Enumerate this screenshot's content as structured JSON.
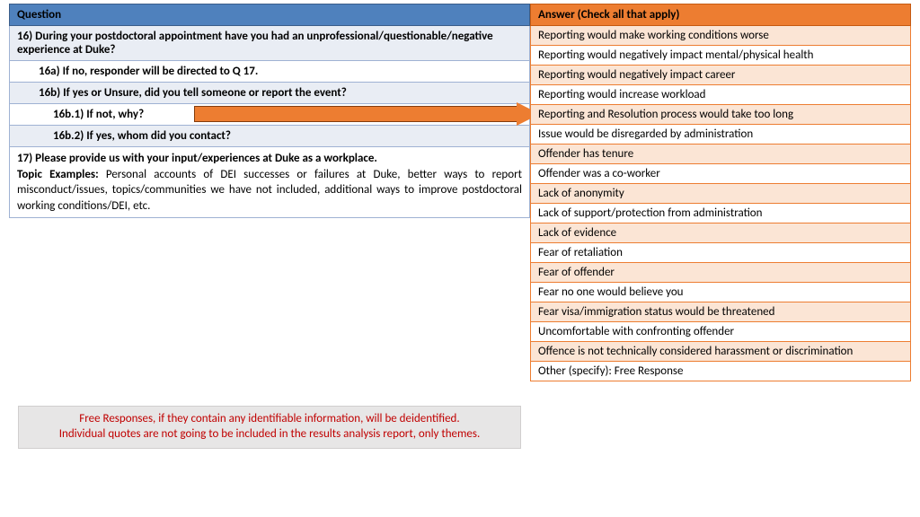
{
  "question_header": "Question",
  "answer_header": "Answer (Check all that apply)",
  "q16": "16) During your postdoctoral appointment have you had an unprofessional/questionable/negative experience at Duke?",
  "q16a": "16a) If no, responder will be directed to Q 17.",
  "q16b": "16b) If yes or Unsure, did you tell someone or report the event?",
  "q16b1": "16b.1) If not, why?",
  "q16b2": "16b.2) If yes, whom did you contact?",
  "q17_bold": "17) Please provide us with your input/experiences at Duke as a workplace.",
  "q17_topic_label": "Topic Examples: ",
  "q17_topic_text": "Personal accounts of DEI successes or failures at Duke, better ways to report misconduct/issues, topics/communities we have not included, additional ways to improve postdoctoral working conditions/DEI, etc.",
  "answers": [
    "Reporting would make working conditions worse",
    "Reporting would negatively impact mental/physical health",
    "Reporting would negatively impact career",
    "Reporting would increase workload",
    "Reporting and Resolution process would take too long",
    "Issue would be disregarded by administration",
    "Offender has tenure",
    "Offender was a co-worker",
    "Lack of anonymity",
    "Lack of support/protection from administration",
    "Lack of evidence",
    "Fear of retaliation",
    "Fear of offender",
    "Fear no one would believe you",
    "Fear visa/immigration status would be threatened",
    "Uncomfortable with confronting offender",
    "Offence is not technically considered harassment or discrimination",
    "Other (specify): Free Response"
  ],
  "footer_line1": "Free Responses, if they contain any identifiable information, will be deidentified.",
  "footer_line2": "Individual quotes are not going to be included in the results analysis report, only themes."
}
